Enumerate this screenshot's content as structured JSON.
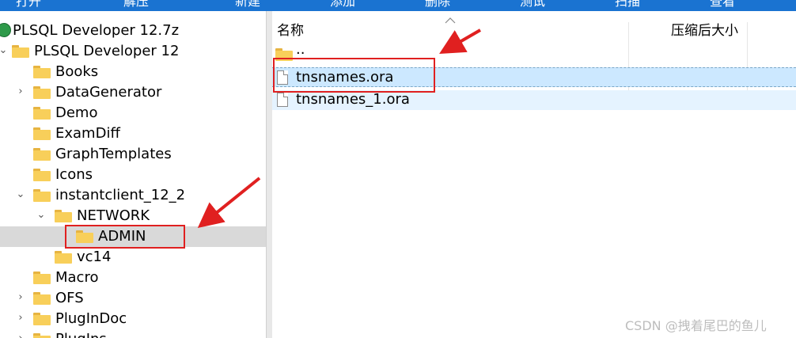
{
  "toolbar": {
    "items": [
      "打开",
      "解压",
      "新建",
      "添加",
      "删除",
      "测试",
      "扫描",
      "查看"
    ]
  },
  "tree": {
    "root_label": "PLSQL Developer 12.7z",
    "items": [
      {
        "label": "PLSQL Developer 12",
        "expanded": true
      },
      {
        "label": "Books"
      },
      {
        "label": "DataGenerator",
        "expandable": true
      },
      {
        "label": "Demo"
      },
      {
        "label": "ExamDiff"
      },
      {
        "label": "GraphTemplates"
      },
      {
        "label": "Icons"
      },
      {
        "label": "instantclient_12_2",
        "expanded": true
      },
      {
        "label": "NETWORK",
        "expanded": true
      },
      {
        "label": "ADMIN",
        "selected": true
      },
      {
        "label": "vc14"
      },
      {
        "label": "Macro"
      },
      {
        "label": "OFS",
        "expandable": true
      },
      {
        "label": "PlugInDoc",
        "expandable": true
      },
      {
        "label": "PlugIns",
        "expandable": true
      }
    ]
  },
  "list": {
    "col_name": "名称",
    "col_compressed": "压缩后大小",
    "parent_label": "..",
    "files": [
      "tnsnames.ora",
      "tnsnames_1.ora"
    ]
  },
  "watermark": "CSDN @拽着尾巴的鱼儿",
  "colors": {
    "toolbar": "#1a73d1",
    "annotation": "#e02020",
    "folder": "#f8cf5a",
    "selection": "#cce8ff"
  }
}
